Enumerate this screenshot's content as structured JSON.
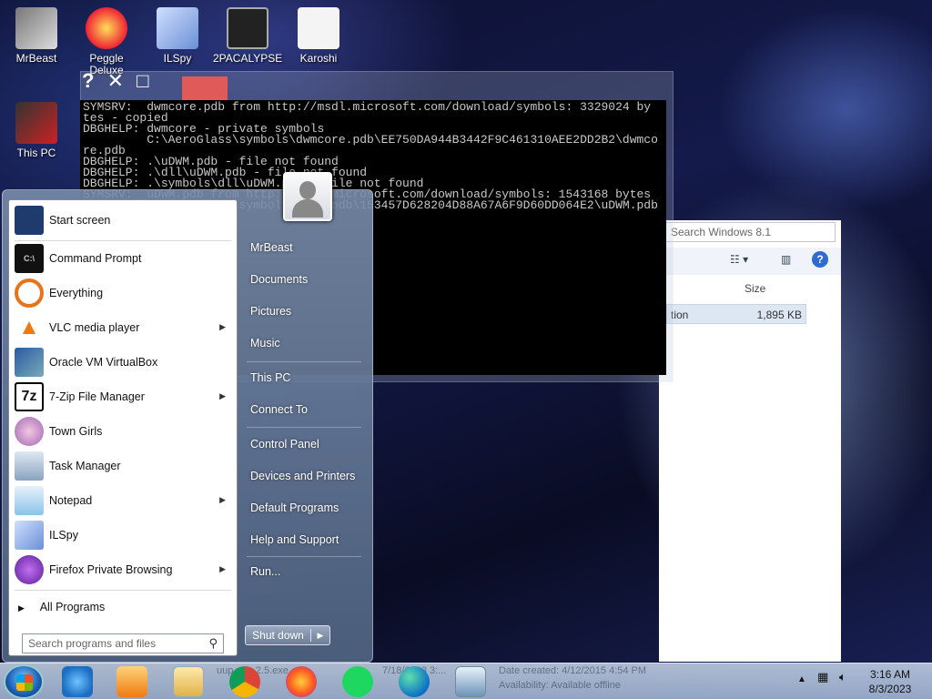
{
  "desktop": {
    "icons": [
      {
        "label": "MrBeast",
        "icon": "mrbeast-shortcut-icon"
      },
      {
        "label": "Peggle Deluxe",
        "icon": "peggle-icon"
      },
      {
        "label": "ILSpy",
        "icon": "ilspy-icon"
      },
      {
        "label": "2PACALYPSE",
        "icon": "console-icon"
      },
      {
        "label": "Karoshi",
        "icon": "karoshi-icon"
      },
      {
        "label": "This PC",
        "icon": "this-pc-icon"
      }
    ]
  },
  "console": {
    "lines": [
      "SYMSRV:  dwmcore.pdb from http://msdl.microsoft.com/download/symbols: 3329024 by",
      "tes - copied",
      "DBGHELP: dwmcore - private symbols",
      "         C:\\AeroGlass\\symbols\\dwmcore.pdb\\EE750DA944B3442F9C461310AEE2DD2B2\\dwmco",
      "re.pdb",
      "DBGHELP: .\\uDWM.pdb - file not found",
      "DBGHELP: .\\dll\\uDWM.pdb - file not found",
      "DBGHELP: .\\symbols\\dll\\uDWM.pdb - file not found",
      "SYMSRV:  uDWM.pdb from http://msdl.microsoft.com/download/symbols: 1543168 bytes",
      "",
      "         C:\\AeroGlass\\symbols\\uDWM.pdb\\153457D628204D88A67A6F9D60DD064E2\\uDWM.pdb"
    ]
  },
  "explorer": {
    "search_placeholder": "Search Windows 8.1",
    "column_size": "Size",
    "row_type": "tion",
    "row_size": "1,895 KB"
  },
  "start_menu": {
    "programs": [
      {
        "label": "Start screen",
        "icon": "start-screen-icon",
        "submenu": false
      },
      {
        "label": "Command Prompt",
        "icon": "command-prompt-icon",
        "submenu": false
      },
      {
        "label": "Everything",
        "icon": "everything-search-icon",
        "submenu": false
      },
      {
        "label": "VLC media player",
        "icon": "vlc-icon",
        "submenu": true
      },
      {
        "label": "Oracle VM VirtualBox",
        "icon": "virtualbox-icon",
        "submenu": false
      },
      {
        "label": "7-Zip File Manager",
        "icon": "7zip-icon",
        "submenu": true
      },
      {
        "label": "Town Girls",
        "icon": "town-girls-icon",
        "submenu": false
      },
      {
        "label": "Task Manager",
        "icon": "task-manager-icon",
        "submenu": false
      },
      {
        "label": "Notepad",
        "icon": "notepad-icon",
        "submenu": true
      },
      {
        "label": "ILSpy",
        "icon": "ilspy-icon",
        "submenu": false
      },
      {
        "label": "Firefox Private Browsing",
        "icon": "firefox-private-icon",
        "submenu": true
      }
    ],
    "all_programs": "All Programs",
    "search_placeholder": "Search programs and files",
    "right_items": [
      "MrBeast",
      "Documents",
      "Pictures",
      "Music",
      "This PC",
      "Connect To",
      "Control Panel",
      "Devices and Printers",
      "Default Programs",
      "Help and Support",
      "Run..."
    ],
    "shutdown_label": "Shut down"
  },
  "taskbar": {
    "pinned": [
      "internet-explorer-icon",
      "media-player-icon",
      "file-explorer-icon",
      "chrome-icon",
      "firefox-icon",
      "spotify-icon",
      "edge-icon",
      "notepad-app-icon"
    ],
    "ghost_text": [
      "uup-v8...2.5.exe",
      "7/18/2023 3:...",
      "Date created: 4/12/2015 4:54 PM",
      "Availability: Available offline"
    ],
    "time": "3:16 AM",
    "date": "8/3/2023"
  },
  "colors": {
    "start_orb": "#1a5fb4",
    "console_bg": "#000000",
    "console_fg": "#c8c8c8"
  }
}
